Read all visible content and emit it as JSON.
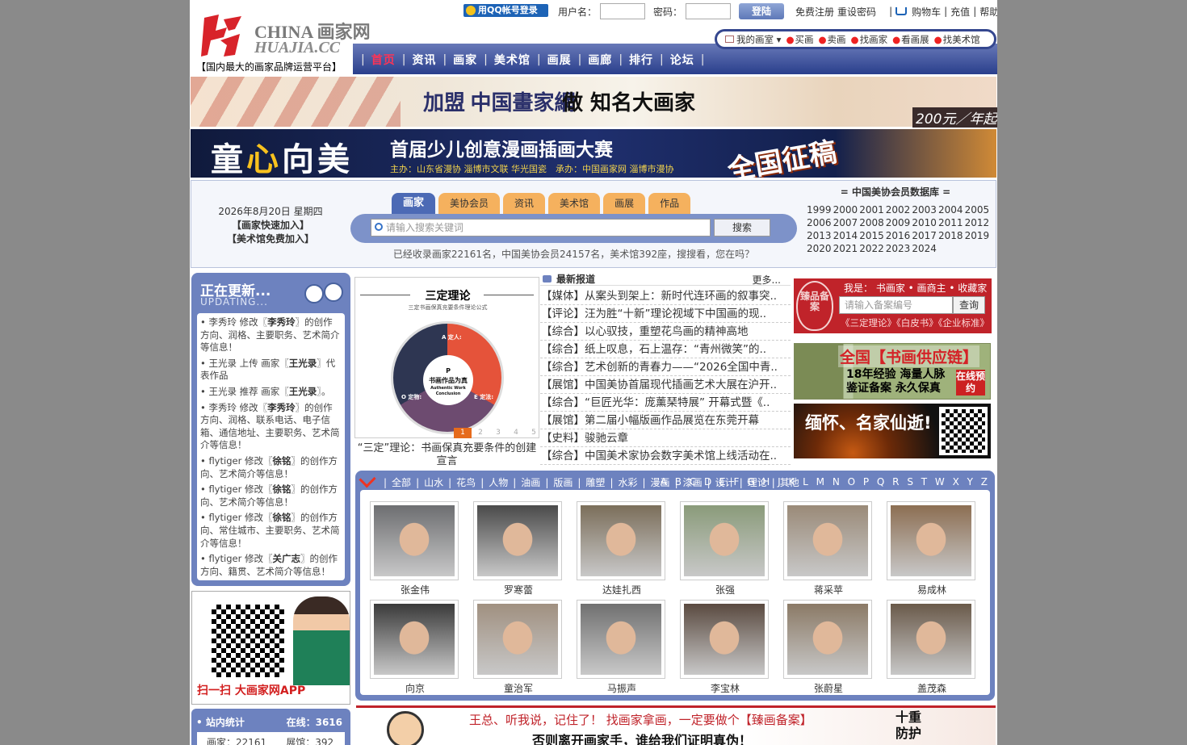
{
  "header": {
    "logo_cn": "CHINA 画家网",
    "logo_en": "HUAJIA.CC",
    "slogan": "【国内最大的画家品牌运营平台】",
    "qq_login": "用QQ帐号登录",
    "username_label": "用户名：",
    "password_label": "密码：",
    "login_button": "登陆",
    "register": "免费注册",
    "reset_password": "重设密码",
    "cart": "购物车",
    "recharge": "充值",
    "help": "帮助"
  },
  "nav": {
    "items": [
      "首页",
      "资讯",
      "画家",
      "美术馆",
      "画展",
      "画廊",
      "排行",
      "论坛"
    ],
    "active": "首页"
  },
  "subnav": {
    "home": "我的画室",
    "items": [
      "买画",
      "卖画",
      "找画家",
      "看画展",
      "找美术馆"
    ]
  },
  "banner1": {
    "text1": "加盟 中国畫家網",
    "text2": "做 知名大画家",
    "price": "200元／年起"
  },
  "banner2": {
    "big": [
      "童",
      "心",
      "向美"
    ],
    "title": "首届少儿创意漫画插画大赛",
    "sponsors": "主办：山东省漫协 淄博市文联 华光国瓷　承办：中国画家网 淄博市漫协",
    "right": "全国征稿"
  },
  "search": {
    "date": "2026年8月20日 星期四",
    "quick_join": "【画家快速加入】",
    "museum_join": "【美术馆免费加入】",
    "tabs": [
      "画家",
      "美协会员",
      "资讯",
      "美术馆",
      "画展",
      "作品"
    ],
    "active_tab": "画家",
    "placeholder": "请输入搜索关键词",
    "button": "搜索",
    "stats": "已经收录画家22161名，中国美协会员24157名，美术馆392座，搜搜看，您在吗？"
  },
  "member_db": {
    "title": "= 中国美协会员数据库 =",
    "years": [
      "1999",
      "2000",
      "2001",
      "2002",
      "2003",
      "2004",
      "2005",
      "2006",
      "2007",
      "2008",
      "2009",
      "2010",
      "2011",
      "2012",
      "2013",
      "2014",
      "2015",
      "2016",
      "2017",
      "2018",
      "2019",
      "2020",
      "2021",
      "2022",
      "2023",
      "2024"
    ]
  },
  "updates": {
    "title": "正在更新...",
    "subtitle": "UPDATING...",
    "items": [
      {
        "pre": "• 李秀玲 修改〖",
        "name": "李秀玲",
        "post": "〗的创作方向、润格、主要职务、艺术简介等信息！"
      },
      {
        "pre": "• 王光录 上传 画家〖",
        "name": "王光录",
        "post": "〗代表作品"
      },
      {
        "pre": "• 王光录 推荐 画家〖",
        "name": "王光录",
        "post": "〗。"
      },
      {
        "pre": "• 李秀玲 修改〖",
        "name": "李秀玲",
        "post": "〗的创作方向、润格、联系电话、电子信箱、通信地址、主要职务、艺术简介等信息！"
      },
      {
        "pre": "• flytiger 修改〖",
        "name": "徐铭",
        "post": "〗的创作方向、艺术简介等信息！"
      },
      {
        "pre": "• flytiger 修改〖",
        "name": "徐铭",
        "post": "〗的创作方向、艺术简介等信息！"
      },
      {
        "pre": "• flytiger 修改〖",
        "name": "徐铭",
        "post": "〗的创作方向、常住城市、主要职务、艺术简介等信息！"
      },
      {
        "pre": "• flytiger 修改〖",
        "name": "关广志",
        "post": "〗的创作方向、籍贯、艺术简介等信息！"
      }
    ]
  },
  "app": {
    "text": "扫一扫 大画家网APP"
  },
  "site_stats": {
    "title": "• 站内统计",
    "online": "在线：3616",
    "painters": "画家：22161",
    "exhibitions": "展馆：392"
  },
  "featured": {
    "title": "三定理论",
    "subtitle": "三定书画保真充要条件理论公式",
    "core": [
      "P",
      "书画作品为真",
      "Authentic Work Conclusion"
    ],
    "segments": [
      "A 定人:",
      "O 定物:",
      "E 定法:"
    ],
    "pages": [
      "1",
      "2",
      "3",
      "4",
      "5"
    ],
    "caption": "“三定”理论：书画保真充要条件的创建宣言"
  },
  "news": {
    "title": "最新报道",
    "more": "更多...",
    "items": [
      "【媒体】从案头到架上：新时代连环画的叙事突..",
      "【评论】汪为胜“十新”理论视域下中国画的现..",
      "【综合】以心驭技，重塑花鸟画的精神高地",
      "【综合】纸上叹息，石上温存：“青州微笑”的..",
      "【综合】艺术创新的青春力——“2026全国中青..",
      "【展馆】中国美协首届现代插画艺术大展在沪开..",
      "【综合】“巨匠光华：庞薰琹特展” 开幕式暨《..",
      "【展馆】第二届小幅版画作品展览在东莞开幕",
      "【史料】骏驰云章",
      "【综合】中国美术家协会数字美术馆上线活动在.."
    ]
  },
  "beian": {
    "seal": "臻品备案",
    "roles": "我是： 书画家 • 画商主 • 收藏家",
    "placeholder": "请输入备案编号",
    "button": "查询",
    "tags": "《三定理论》《白皮书》《企业标准》"
  },
  "supply": {
    "title": "全国【书画供应链】",
    "line1": "18年经验 海量人脉",
    "line2": "鉴证备案 永久保真",
    "badge": "在线预约"
  },
  "memorial": {
    "title": "缅怀、名家仙逝!"
  },
  "artists": {
    "categories": [
      "全部",
      "山水",
      "花鸟",
      "人物",
      "油画",
      "版画",
      "雕塑",
      "水彩",
      "漫画",
      "漆画",
      "设计",
      "理论",
      "其他"
    ],
    "alphabet": "A B C D E F G H J K L M N O P Q R S T W X Y Z",
    "names": [
      "张金伟",
      "罗寒蕾",
      "达娃扎西",
      "张强",
      "蒋采苹",
      "易成林",
      "向京",
      "童治军",
      "马振声",
      "李宝林",
      "张蔚星",
      "盖茂森"
    ]
  },
  "bottom_ad": {
    "line1": "王总、听我说，记住了！ 找画家拿画，一定要做个【臻画备案】",
    "line2": "否则离开画家手，谁给我们证明真伪！",
    "stamp": "十重防护"
  },
  "colors": {
    "nav_blue": "#2a3f8c",
    "panel_blue": "#6d82bf",
    "brand_red": "#c0232a",
    "tab_orange": "#f5b15e"
  }
}
